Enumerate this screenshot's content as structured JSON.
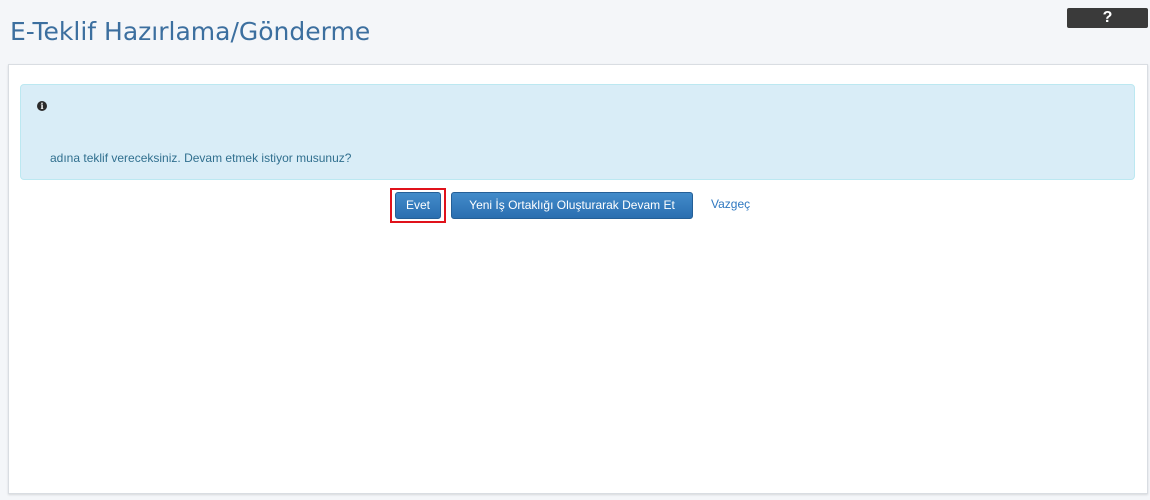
{
  "header": {
    "title": "E-Teklif Hazırlama/Gönderme",
    "help_label": "?"
  },
  "alert": {
    "icon": "info-circle-icon",
    "message": "adına teklif vereceksiniz. Devam etmek istiyor musunuz?"
  },
  "actions": {
    "yes_label": "Evet",
    "new_joint_venture_label": "Yeni İş Ortaklığı Oluşturarak Devam Et",
    "cancel_label": "Vazgeç"
  },
  "colors": {
    "title": "#3c6f9f",
    "alert_background": "#d9edf7",
    "alert_text": "#31708f",
    "primary_button": "#337ab7",
    "highlight_border": "#e0121b",
    "help_button": "#3a3a3a"
  }
}
